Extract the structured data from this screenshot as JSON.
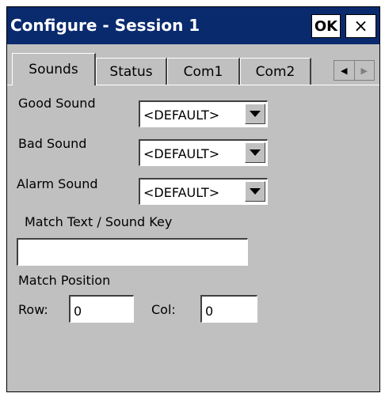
{
  "window": {
    "title": "Configure - Session 1",
    "ok_label": "OK",
    "close_label": "×"
  },
  "tabs": [
    {
      "label": "Sounds",
      "active": true
    },
    {
      "label": "Status",
      "active": false
    },
    {
      "label": "Com1",
      "active": false
    },
    {
      "label": "Com2",
      "active": false
    }
  ],
  "tab_scroll": {
    "left": "◀",
    "right": "▶"
  },
  "sounds": {
    "good_label": "Good Sound",
    "good_value": "<DEFAULT>",
    "bad_label": "Bad Sound",
    "bad_value": "<DEFAULT>",
    "alarm_label": "Alarm Sound",
    "alarm_value": "<DEFAULT>",
    "match_text_label": "Match Text / Sound Key",
    "match_text_value": "",
    "match_position_label": "Match Position",
    "row_label": "Row:",
    "row_value": "0",
    "col_label": "Col:",
    "col_value": "0"
  },
  "colors": {
    "titlebar": "#0a2a6e",
    "window_bg": "#c0c0c0"
  }
}
